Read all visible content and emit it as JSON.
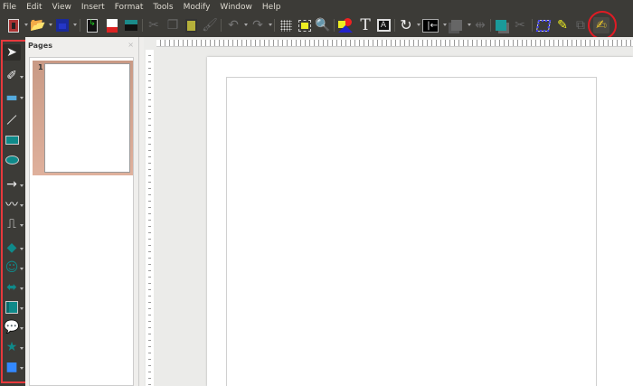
{
  "menu": [
    "File",
    "Edit",
    "View",
    "Insert",
    "Format",
    "Tools",
    "Modify",
    "Window",
    "Help"
  ],
  "toolbar_icons": [
    "new-document",
    "open",
    "save",
    "export",
    "export-pdf",
    "print",
    "cut",
    "copy",
    "paste",
    "clone-formatting",
    "undo",
    "redo",
    "grid",
    "helplines",
    "zoom",
    "basic-shapes",
    "text",
    "fontwork-text-box",
    "rotate",
    "align",
    "arrange",
    "distribute",
    "shadow",
    "crop",
    "points",
    "glue-points",
    "highlighter",
    "freeform-curve"
  ],
  "highlighted_tool": "freeform-curve",
  "drawing_tools": [
    "select",
    "line-fill-color",
    "fill-color",
    "line",
    "rectangle",
    "ellipse",
    "line-arrow",
    "curve",
    "connector",
    "basic-shapes",
    "symbol-shapes",
    "block-arrows",
    "flowchart",
    "callouts",
    "stars",
    "3d-objects"
  ],
  "pages_panel": {
    "title": "Pages",
    "close": "×",
    "pages": [
      {
        "number": "1"
      }
    ]
  },
  "colors": {
    "accent": "#0f8a8a",
    "highlight": "#e01b24"
  }
}
